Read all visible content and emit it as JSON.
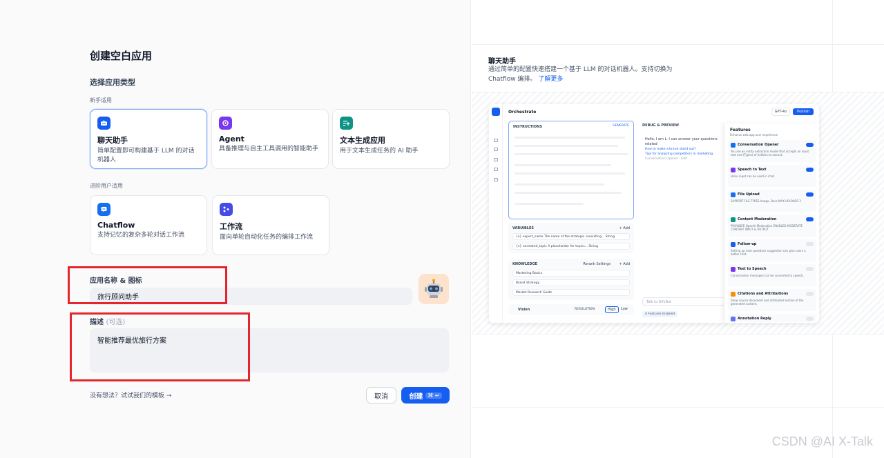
{
  "form": {
    "title": "创建空白应用",
    "section_title": "选择应用类型",
    "beginner_label": "新手适用",
    "advanced_label": "进阶用户适用",
    "app_types_beginner": [
      {
        "name": "聊天助手",
        "desc": "简单配置即可构建基于 LLM 的对话机器人",
        "icon": "chat-bot-icon",
        "color": "#155eef",
        "selected": true
      },
      {
        "name": "Agent",
        "desc": "具备推理与自主工具调用的智能助手",
        "icon": "agent-icon",
        "color": "#7839ee",
        "selected": false
      },
      {
        "name": "文本生成应用",
        "desc": "用于文本生成任务的 AI 助手",
        "icon": "text-generation-icon",
        "color": "#0e9384",
        "selected": false
      }
    ],
    "app_types_advanced": [
      {
        "name": "Chatflow",
        "desc": "支持记忆的复杂多轮对话工作流",
        "icon": "chatflow-icon",
        "color": "#1570ef"
      },
      {
        "name": "工作流",
        "desc": "面向单轮自动化任务的编排工作流",
        "icon": "workflow-icon",
        "color": "#444ce7"
      }
    ],
    "name_label": "应用名称 & 图标",
    "name_value": "旅行顾问助手",
    "desc_label": "描述",
    "desc_optional": "(可选)",
    "desc_value": "智能推荐最优旅行方案",
    "template_hint": "没有想法？试试我们的模板 →",
    "cancel_label": "取消",
    "create_label": "创建",
    "create_shortcut": "⌘ ↵"
  },
  "preview": {
    "title": "聊天助手",
    "desc": "通过简单的配置快速搭建一个基于 LLM 的对话机器人。支持切换为 Chatflow 编排。",
    "learn_more": "了解更多",
    "mock": {
      "header": "Orchestrate",
      "model": "GPT-4o",
      "publish": "Publish",
      "instructions": "INSTRUCTIONS",
      "generate": "GENERATE",
      "variables": "VARIABLES",
      "add": "+ Add",
      "var_rows": [
        "{x} expert_name  The name of the strategic consulting...  String",
        "{x} unrelated_topic  A placeholder for topics...  String"
      ],
      "knowledge": "KNOWLEDGE",
      "rerank": "Rerank Settings",
      "knowledge_rows": [
        "Marketing Basics",
        "Brand Strategy",
        "Market Research Guide"
      ],
      "vision": "Vision",
      "resolution": "RESOLUTION",
      "high": "High",
      "low": "Low",
      "debug": "DEBUG & PREVIEW",
      "greeting": "Hello, I am L. I can answer your questions related",
      "suggestions": [
        "How to make a brand stand out?",
        "Tips for analyzing competitors in marketing"
      ],
      "opener_note": "Conversation Opener · Edit",
      "talk_placeholder": "Talk to DifyBot",
      "features_enabled": "4 Features Enabled",
      "features_title": "Features",
      "features_sub": "Enhance web app user experience",
      "features": [
        {
          "name": "Conversation Opener",
          "desc": "You are an entity extraction model that accepts an input text and (Types) of entities to extract.",
          "on": true,
          "color": "#1570ef"
        },
        {
          "name": "Speech to Text",
          "desc": "Voice input can be used in chat.",
          "on": true,
          "color": "#7839ee"
        },
        {
          "name": "File Upload",
          "desc": "SUPPORT FILE TYPES Image, Docs   MAX UPLOADS 3",
          "on": true,
          "color": "#1570ef"
        },
        {
          "name": "Content Moderation",
          "desc": "PROVIDER OpenAI Moderation   ENABLED MODERATE CONTENT INPUT & OUTPUT",
          "on": true,
          "color": "#0e9384"
        },
        {
          "name": "Follow-up",
          "desc": "Setting up next questions suggestion can give users a better chat.",
          "on": false,
          "color": "#155eef"
        },
        {
          "name": "Text to Speech",
          "desc": "Conversation messages can be converted to speech.",
          "on": false,
          "color": "#7839ee"
        },
        {
          "name": "Citations and Attributions",
          "desc": "Show source document and attributed section of the generated content.",
          "on": false,
          "color": "#f79009"
        },
        {
          "name": "Annotation Reply",
          "desc": "",
          "on": false,
          "color": "#6172f3"
        }
      ]
    }
  },
  "watermark": "CSDN @AI X-Talk"
}
